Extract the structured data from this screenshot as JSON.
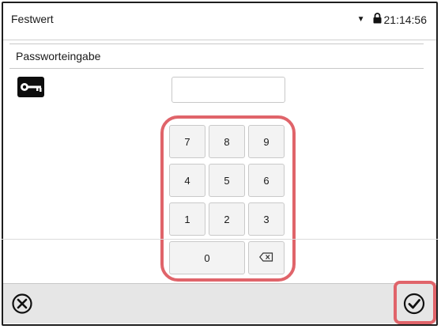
{
  "titlebar": {
    "title": "Festwert",
    "time": "21:14:56"
  },
  "dialog": {
    "title": "Passworteingabe"
  },
  "password": {
    "value": "",
    "placeholder": ""
  },
  "keypad": {
    "rows": [
      [
        "7",
        "8",
        "9"
      ],
      [
        "4",
        "5",
        "6"
      ],
      [
        "1",
        "2",
        "3"
      ]
    ],
    "zero": "0"
  },
  "icons": {
    "dropdown": "triangle-down-icon",
    "lock": "lock-icon",
    "key": "key-icon",
    "backspace": "backspace-icon",
    "cancel": "cancel-circle-x-icon",
    "confirm": "check-circle-icon"
  },
  "colors": {
    "highlight": "#e0646a",
    "bottombar": "#e6e6e6",
    "key_bg": "#f3f3f3"
  }
}
